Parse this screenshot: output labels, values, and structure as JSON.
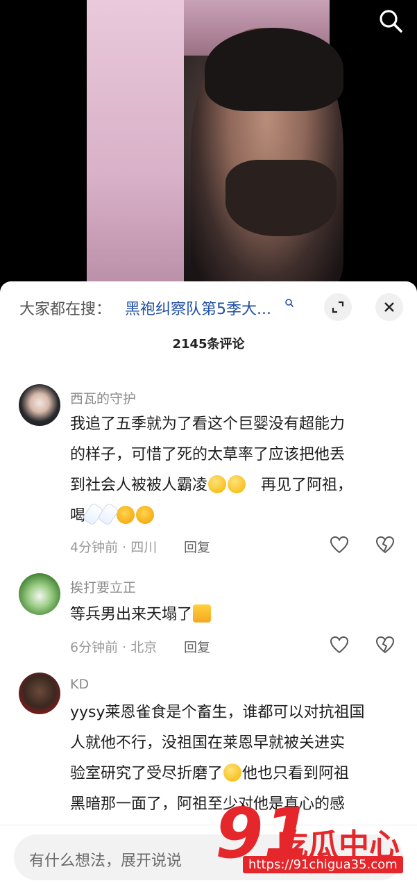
{
  "video": {
    "search_icon": "search-icon"
  },
  "sheet": {
    "hot_prefix": "大家都在搜：",
    "hot_link": "黑袍纠察队第5季大...",
    "comment_count": "2145条评论"
  },
  "comments": [
    {
      "user": "西瓦的守护",
      "line1": "我追了五季就为了看这个巨婴没有超能力",
      "line2": "的样子，可惜了死的太草率了应该把他丢",
      "line3a": "到社会人被被人霸凌",
      "line3b": "再见了阿祖，",
      "line4": "喝",
      "time_loc": "4分钟前 · 四川",
      "reply": "回复"
    },
    {
      "user": "挨打要立正",
      "line1": "等兵男出来天塌了",
      "time_loc": "6分钟前 · 北京",
      "reply": "回复"
    },
    {
      "user": "KD",
      "line1": "yysy莱恩雀食是个畜生，谁都可以对抗祖国",
      "line2": "人就他不行，没祖国在莱恩早就被关进实",
      "line3a": "验室研究了受尽折磨了",
      "line3b": "他也只看到阿祖",
      "line4": "黑暗那一面了，阿祖至少对他是真心的感"
    }
  ],
  "input": {
    "placeholder": "有什么想法，展开说说"
  },
  "watermark": {
    "num": "91",
    "text": "吃瓜中心",
    "url": "https://91chigua35.com"
  }
}
